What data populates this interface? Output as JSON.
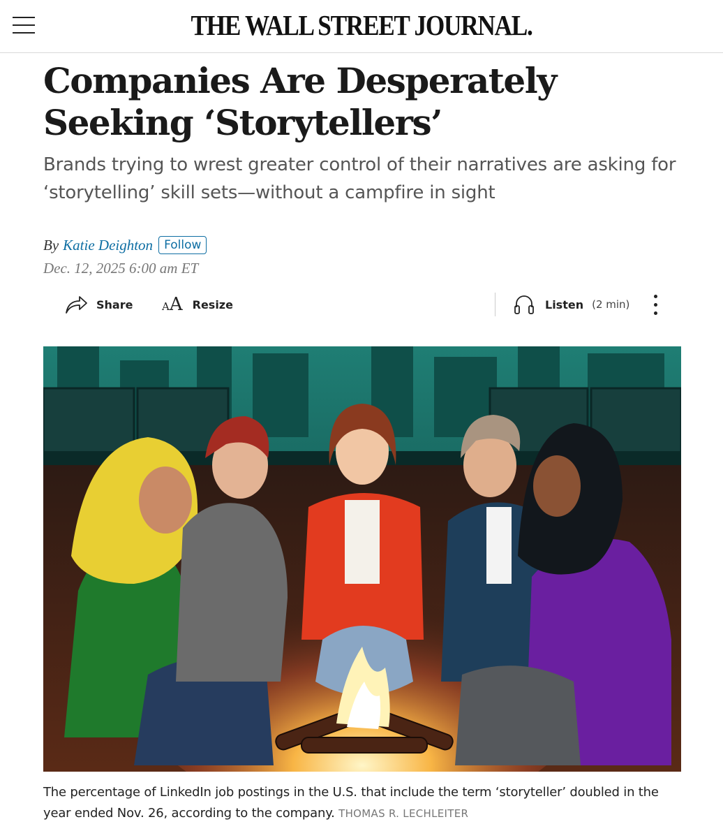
{
  "header": {
    "masthead": "THE WALL STREET JOURNAL."
  },
  "article": {
    "headline": "Companies Are Desperately Seeking ‘Storytellers’",
    "dek": "Brands trying to wrest greater control of their narratives are asking for ‘storytelling’ skill sets—without a campfire in sight",
    "by": "By",
    "author": "Katie Deighton",
    "follow_label": "Follow",
    "date": "Dec. 12, 2025 6:00 am ET"
  },
  "toolbar": {
    "share_label": "Share",
    "resize_label": "Resize",
    "listen_label": "Listen",
    "listen_duration": "(2 min)"
  },
  "image": {
    "caption": "The percentage of LinkedIn job postings in the U.S. that include the term ‘storyteller’ doubled in the year ended Nov. 26, according to the company.",
    "credit": "THOMAS R. LECHLEITER"
  },
  "icons": {
    "menu": "hamburger-menu-icon",
    "share": "share-arrow-icon",
    "resize": "text-resize-icon",
    "listen": "headphones-icon",
    "more": "vertical-ellipsis-icon"
  },
  "colors": {
    "link": "#0e6ea3",
    "headline": "#1a1a1a",
    "dek": "#555555"
  }
}
